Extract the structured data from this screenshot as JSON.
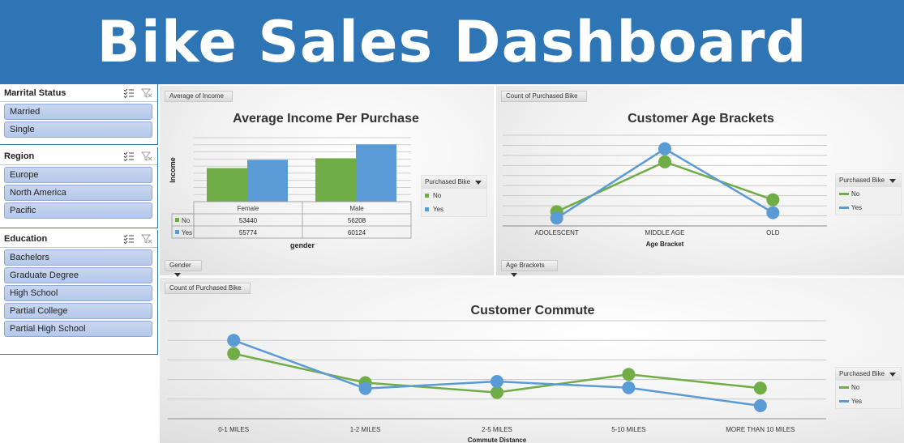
{
  "header": {
    "title": "Bike Sales Dashboard"
  },
  "slicers": {
    "marital": {
      "title": "Marrital Status",
      "items": [
        "Married",
        "Single"
      ]
    },
    "region": {
      "title": "Region",
      "items": [
        "Europe",
        "North America",
        "Pacific"
      ]
    },
    "education": {
      "title": "Education",
      "items": [
        "Bachelors",
        "Graduate Degree",
        "High School",
        "Partial College",
        "Partial High School"
      ]
    }
  },
  "colors": {
    "header": "#2E75B6",
    "no": "#70AD47",
    "yes": "#5B9BD5",
    "slicer_item": "#B4C8EA"
  },
  "income_panel": {
    "value_button": "Average of Income",
    "axis_button": "Gender",
    "legend_title": "Purchased Bike",
    "legend_items": [
      "No",
      "Yes"
    ]
  },
  "age_panel": {
    "value_button": "Count of Purchased Bike",
    "axis_button": "Age Brackets",
    "legend_title": "Purchased Bike",
    "legend_items": [
      "No",
      "Yes"
    ]
  },
  "commute_panel": {
    "value_button": "Count of Purchased Bike",
    "legend_title": "Purchased Bike",
    "legend_items": [
      "No",
      "Yes"
    ]
  },
  "chart_data": [
    {
      "type": "bar",
      "title": "Average Income Per Purchase",
      "xlabel": "gender",
      "ylabel": "Income",
      "categories": [
        "Female",
        "Male"
      ],
      "series": [
        {
          "name": "No",
          "values": [
            53440,
            56208
          ]
        },
        {
          "name": "Yes",
          "values": [
            55774,
            60124
          ]
        }
      ],
      "ylim": [
        44000,
        62000
      ],
      "grid": true,
      "data_table": true,
      "legend": "right"
    },
    {
      "type": "line",
      "title": "Customer Age Brackets",
      "xlabel": "Age Bracket",
      "ylabel": "",
      "categories": [
        "ADOLESCENT",
        "MIDDLE AGE",
        "OLD"
      ],
      "series": [
        {
          "name": "No",
          "values": [
            71,
            318,
            130
          ]
        },
        {
          "name": "Yes",
          "values": [
            39,
            383,
            66
          ]
        }
      ],
      "ylim": [
        0,
        450
      ],
      "grid": true,
      "legend": "right"
    },
    {
      "type": "line",
      "title": "Customer Commute",
      "xlabel": "Commute Distance",
      "ylabel": "",
      "categories": [
        "0-1 MILES",
        "1-2 MILES",
        "2-5 MILES",
        "5-10 MILES",
        "MORE THAN 10 MILES"
      ],
      "series": [
        {
          "name": "No",
          "values": [
            166,
            92,
            67,
            113,
            78
          ]
        },
        {
          "name": "Yes",
          "values": [
            200,
            77,
            95,
            79,
            33
          ]
        }
      ],
      "ylim": [
        0,
        250
      ],
      "grid": true,
      "legend": "right"
    }
  ]
}
